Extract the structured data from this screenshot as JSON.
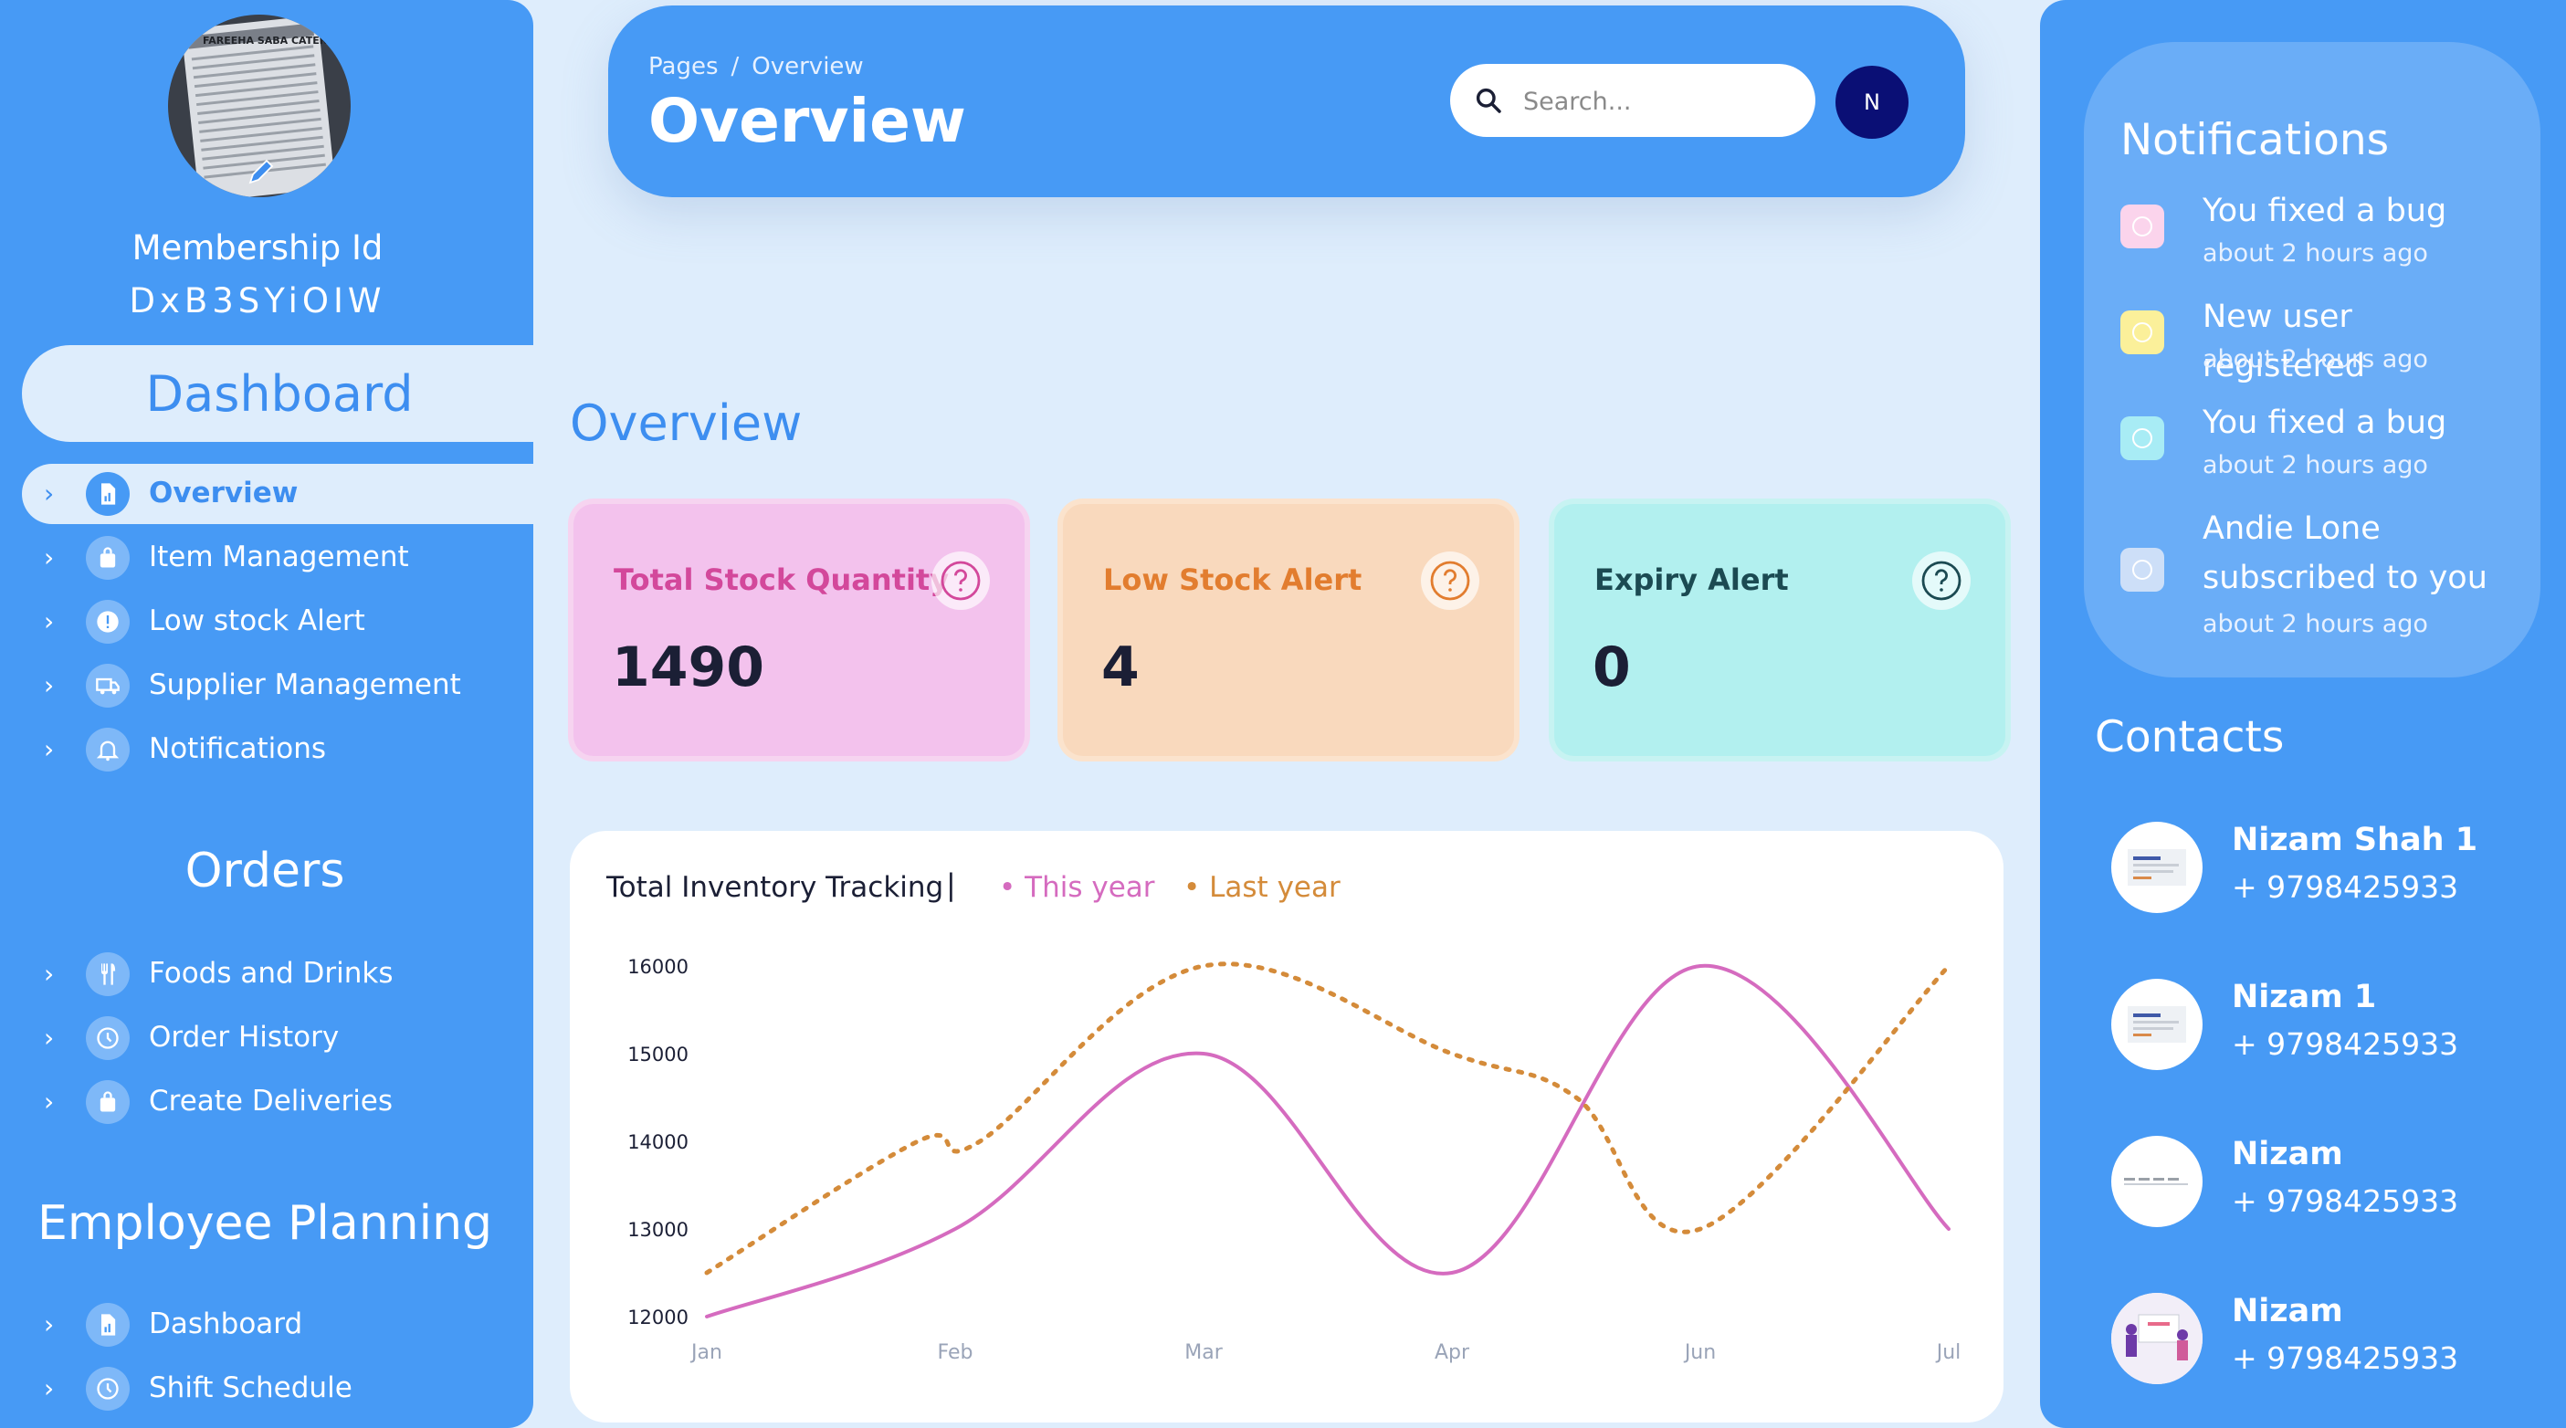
{
  "sidebar": {
    "avatar_caption": "FAREEHA SABA CATERING",
    "membership_label": "Membership Id",
    "membership_id": "DxB3SYiOIW",
    "dashboard_label": "Dashboard",
    "main_items": [
      {
        "label": "Overview",
        "icon": "file-chart-icon"
      },
      {
        "label": "Item Management",
        "icon": "bag-icon"
      },
      {
        "label": "Low stock Alert",
        "icon": "alert-icon"
      },
      {
        "label": "Supplier Management",
        "icon": "truck-icon"
      },
      {
        "label": "Notifications",
        "icon": "bell-icon"
      }
    ],
    "orders_title": "Orders",
    "orders_items": [
      {
        "label": "Foods and Drinks",
        "icon": "utensils-icon"
      },
      {
        "label": "Order History",
        "icon": "history-icon"
      },
      {
        "label": "Create Deliveries",
        "icon": "bag-icon"
      }
    ],
    "employee_title": "Employee Planning",
    "employee_items": [
      {
        "label": "Dashboard",
        "icon": "file-chart-icon"
      },
      {
        "label": "Shift Schedule",
        "icon": "history-icon"
      }
    ]
  },
  "header": {
    "breadcrumb_root": "Pages",
    "breadcrumb_sep": "/",
    "breadcrumb_current": "Overview",
    "title": "Overview",
    "search_placeholder": "Search...",
    "user_initial": "N"
  },
  "main": {
    "section_title": "Overview",
    "cards": [
      {
        "title": "Total Stock Quantity",
        "value": "1490"
      },
      {
        "title": "Low Stock Alert",
        "value": "4"
      },
      {
        "title": "Expiry Alert",
        "value": "0"
      }
    ]
  },
  "chart": {
    "title": "Total Inventory Tracking",
    "divider": "|",
    "legend_this": "This year",
    "legend_last": "Last year"
  },
  "chart_data": {
    "type": "line",
    "title": "Total Inventory Tracking",
    "x": [
      "Jan",
      "Feb",
      "Mar",
      "Apr",
      "Jun",
      "Jul"
    ],
    "y_ticks": [
      "16000",
      "15000",
      "14000",
      "13000",
      "12000"
    ],
    "ylim": [
      12000,
      16000
    ],
    "series": [
      {
        "name": "This year",
        "color": "#d56bbf",
        "style": "solid",
        "points": [
          [
            0,
            12000
          ],
          [
            1,
            13000
          ],
          [
            2,
            15000
          ],
          [
            3,
            12500
          ],
          [
            4,
            16000
          ],
          [
            5,
            13000
          ]
        ]
      },
      {
        "name": "Last year",
        "color": "#d48b3a",
        "style": "dotted",
        "points": [
          [
            0,
            12500
          ],
          [
            0.85,
            14000
          ],
          [
            1.1,
            14000
          ],
          [
            2,
            16000
          ],
          [
            3,
            15000
          ],
          [
            3.5,
            14500
          ],
          [
            4,
            13000
          ],
          [
            5,
            16000
          ]
        ]
      }
    ],
    "grid": false,
    "legend": "top-left"
  },
  "right_panel": {
    "notifications_title": "Notifications",
    "notifications": [
      {
        "text": "You fixed a bug",
        "time": "about 2 hours ago",
        "color": "#fbd4ec"
      },
      {
        "text": "New user registered",
        "time": "about 2 hours ago",
        "color": "#fbf09a"
      },
      {
        "text": "You fixed a bug",
        "time": "about 2 hours ago",
        "color": "#a8ecf5"
      },
      {
        "text_line1": "Andie Lone",
        "text_line2": "subscribed to you",
        "time": "about 2 hours ago",
        "color": "#cddff8"
      }
    ],
    "contacts_title": "Contacts",
    "contacts": [
      {
        "name": "Nizam Shah 1",
        "phone": "+ 9798425933"
      },
      {
        "name": "Nizam 1",
        "phone": "+ 9798425933"
      },
      {
        "name": "Nizam",
        "phone": "+ 9798425933"
      },
      {
        "name": "Nizam",
        "phone": "+ 9798425933"
      }
    ]
  }
}
